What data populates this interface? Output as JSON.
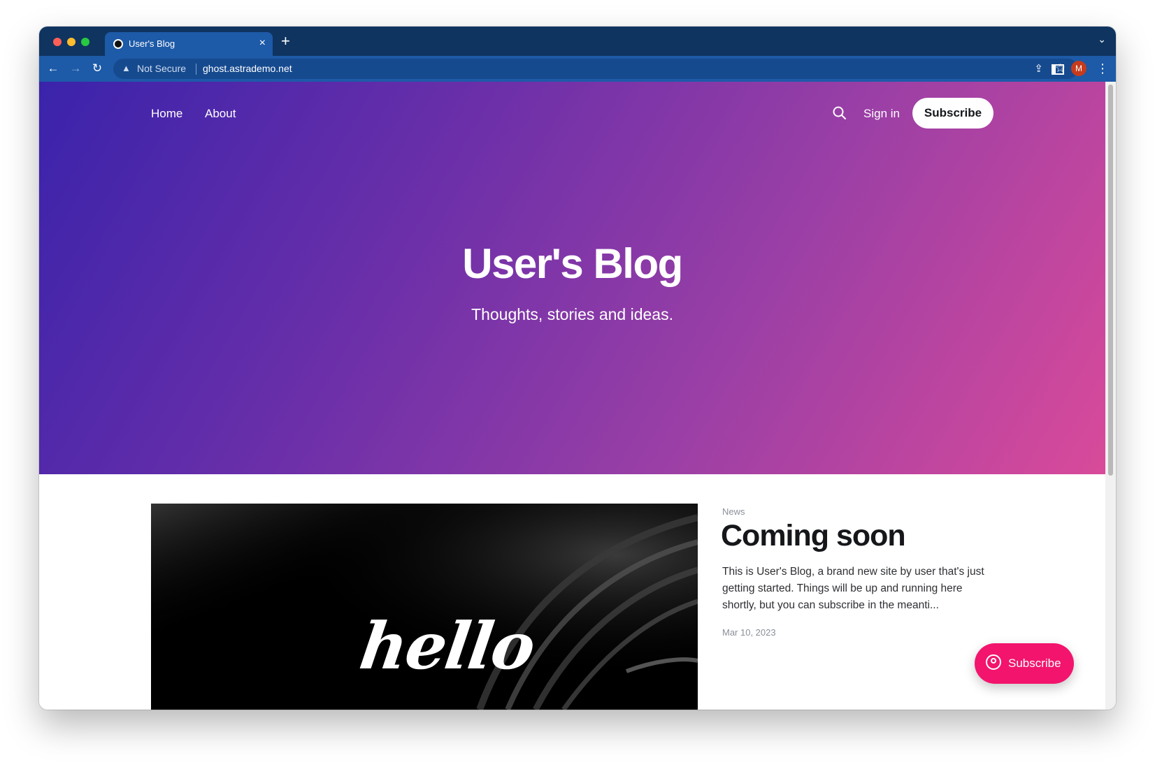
{
  "browser": {
    "tab_title": "User's Blog",
    "tab_close": "×",
    "new_tab": "+",
    "tab_dropdown": "⌄",
    "security_label": "Not Secure",
    "url": "ghost.astrademo.net",
    "profile_initial": "M"
  },
  "site": {
    "nav": {
      "home": "Home",
      "about": "About"
    },
    "signin": "Sign in",
    "subscribe": "Subscribe",
    "title": "User's Blog",
    "subtitle": "Thoughts, stories and ideas."
  },
  "featured_post": {
    "tag": "News",
    "title": "Coming soon",
    "excerpt": "This is User's Blog, a brand new site by user that's just getting started. Things will be up and running here shortly, but you can subscribe in the meanti...",
    "date": "Mar 10, 2023",
    "image_text": "hello"
  },
  "portal": {
    "label": "Subscribe"
  },
  "colors": {
    "hero_gradient_start": "#3a23ab",
    "hero_gradient_end": "#d94a9a",
    "portal_accent": "#f2146d",
    "browser_frame": "#0f3460",
    "browser_toolbar": "#1d5aa8"
  }
}
